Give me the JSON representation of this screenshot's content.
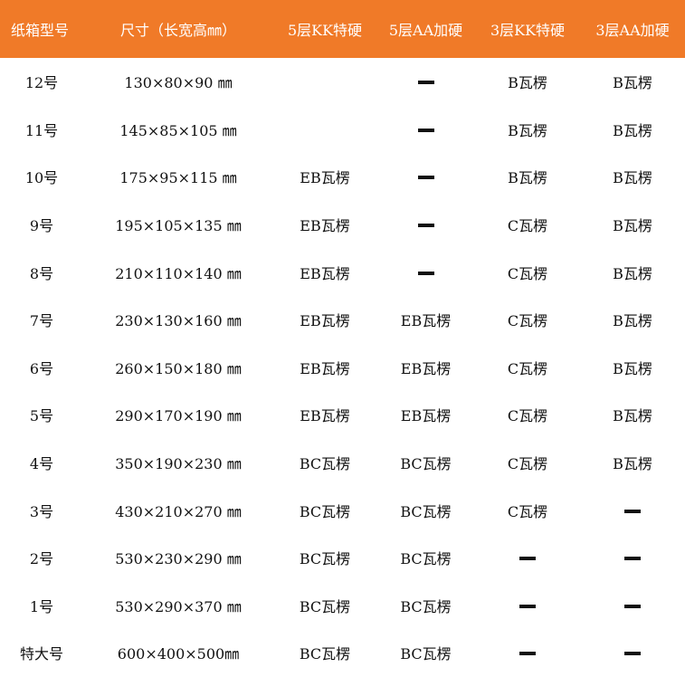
{
  "table": {
    "headers": [
      "纸箱型号",
      "尺寸（长宽高㎜）",
      "5层KK特硬",
      "5层AA加硬",
      "3层KK特硬",
      "3层AA加硬"
    ],
    "rows": [
      [
        "12号",
        "130×80×90 ㎜",
        "",
        "—",
        "B瓦楞",
        "B瓦楞"
      ],
      [
        "11号",
        "145×85×105 ㎜",
        "",
        "—",
        "B瓦楞",
        "B瓦楞"
      ],
      [
        "10号",
        "175×95×115 ㎜",
        "EB瓦楞",
        "—",
        "B瓦楞",
        "B瓦楞"
      ],
      [
        "9号",
        "195×105×135 ㎜",
        "EB瓦楞",
        "—",
        "C瓦楞",
        "B瓦楞"
      ],
      [
        "8号",
        "210×110×140 ㎜",
        "EB瓦楞",
        "—",
        "C瓦楞",
        "B瓦楞"
      ],
      [
        "7号",
        "230×130×160 ㎜",
        "EB瓦楞",
        "EB瓦楞",
        "C瓦楞",
        "B瓦楞"
      ],
      [
        "6号",
        "260×150×180 ㎜",
        "EB瓦楞",
        "EB瓦楞",
        "C瓦楞",
        "B瓦楞"
      ],
      [
        "5号",
        "290×170×190 ㎜",
        "EB瓦楞",
        "EB瓦楞",
        "C瓦楞",
        "B瓦楞"
      ],
      [
        "4号",
        "350×190×230 ㎜",
        "BC瓦楞",
        "BC瓦楞",
        "C瓦楞",
        "B瓦楞"
      ],
      [
        "3号",
        "430×210×270 ㎜",
        "BC瓦楞",
        "BC瓦楞",
        "C瓦楞",
        "—"
      ],
      [
        "2号",
        "530×230×290 ㎜",
        "BC瓦楞",
        "BC瓦楞",
        "—",
        "—"
      ],
      [
        "1号",
        "530×290×370 ㎜",
        "BC瓦楞",
        "BC瓦楞",
        "—",
        "—"
      ],
      [
        "特大号",
        "600×400×500㎜",
        "BC瓦楞",
        "BC瓦楞",
        "—",
        "—"
      ]
    ]
  },
  "colors": {
    "header_background": "#f07a28",
    "header_text": "#ffffff",
    "body_text": "#111111"
  }
}
